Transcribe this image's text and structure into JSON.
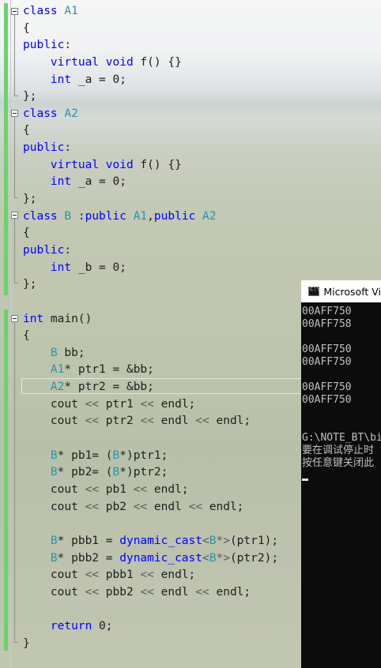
{
  "editor": {
    "lines": [
      [
        {
          "t": "class ",
          "c": "kw"
        },
        {
          "t": "A1",
          "c": "ty"
        }
      ],
      [
        {
          "t": "{"
        }
      ],
      [
        {
          "t": "public",
          "c": "kw"
        },
        {
          "t": ":"
        }
      ],
      [
        {
          "t": "    virtual ",
          "c": "kw"
        },
        {
          "t": "void ",
          "c": "kw"
        },
        {
          "t": "f() {}"
        }
      ],
      [
        {
          "t": "    int ",
          "c": "kw"
        },
        {
          "t": "_a = 0;"
        }
      ],
      [
        {
          "t": "};"
        }
      ],
      [
        {
          "t": "class ",
          "c": "kw"
        },
        {
          "t": "A2",
          "c": "ty"
        }
      ],
      [
        {
          "t": "{"
        }
      ],
      [
        {
          "t": "public",
          "c": "kw"
        },
        {
          "t": ":"
        }
      ],
      [
        {
          "t": "    virtual ",
          "c": "kw"
        },
        {
          "t": "void ",
          "c": "kw"
        },
        {
          "t": "f() {}"
        }
      ],
      [
        {
          "t": "    int ",
          "c": "kw"
        },
        {
          "t": "_a = 0;"
        }
      ],
      [
        {
          "t": "};"
        }
      ],
      [
        {
          "t": "class ",
          "c": "kw"
        },
        {
          "t": "B",
          "c": "ty"
        },
        {
          "t": " :"
        },
        {
          "t": "public ",
          "c": "kw"
        },
        {
          "t": "A1",
          "c": "ty"
        },
        {
          "t": ","
        },
        {
          "t": "public ",
          "c": "kw"
        },
        {
          "t": "A2",
          "c": "ty"
        }
      ],
      [
        {
          "t": "{"
        }
      ],
      [
        {
          "t": "public",
          "c": "kw"
        },
        {
          "t": ":"
        }
      ],
      [
        {
          "t": "    int ",
          "c": "kw"
        },
        {
          "t": "_b = 0;"
        }
      ],
      [
        {
          "t": "};"
        }
      ],
      [
        {
          "t": ""
        }
      ],
      [
        {
          "t": "int ",
          "c": "kw"
        },
        {
          "t": "main()"
        }
      ],
      [
        {
          "t": "{"
        }
      ],
      [
        {
          "t": "    "
        },
        {
          "t": "B",
          "c": "ty"
        },
        {
          "t": " bb;"
        }
      ],
      [
        {
          "t": "    "
        },
        {
          "t": "A1",
          "c": "ty"
        },
        {
          "t": "* ptr1 = &bb;"
        }
      ],
      [
        {
          "t": "    "
        },
        {
          "t": "A2",
          "c": "ty"
        },
        {
          "t": "* ptr2 = &bb;"
        }
      ],
      [
        {
          "t": "    cout "
        },
        {
          "t": "<<",
          "c": "op"
        },
        {
          "t": " ptr1 "
        },
        {
          "t": "<<",
          "c": "op"
        },
        {
          "t": " endl;"
        }
      ],
      [
        {
          "t": "    cout "
        },
        {
          "t": "<<",
          "c": "op"
        },
        {
          "t": " ptr2 "
        },
        {
          "t": "<<",
          "c": "op"
        },
        {
          "t": " endl "
        },
        {
          "t": "<<",
          "c": "op"
        },
        {
          "t": " endl;"
        }
      ],
      [
        {
          "t": ""
        }
      ],
      [
        {
          "t": "    "
        },
        {
          "t": "B",
          "c": "ty"
        },
        {
          "t": "* pb1= ("
        },
        {
          "t": "B",
          "c": "ty"
        },
        {
          "t": "*)ptr1;"
        }
      ],
      [
        {
          "t": "    "
        },
        {
          "t": "B",
          "c": "ty"
        },
        {
          "t": "* pb2= ("
        },
        {
          "t": "B",
          "c": "ty"
        },
        {
          "t": "*)ptr2;"
        }
      ],
      [
        {
          "t": "    cout "
        },
        {
          "t": "<<",
          "c": "op"
        },
        {
          "t": " pb1 "
        },
        {
          "t": "<<",
          "c": "op"
        },
        {
          "t": " endl;"
        }
      ],
      [
        {
          "t": "    cout "
        },
        {
          "t": "<<",
          "c": "op"
        },
        {
          "t": " pb2 "
        },
        {
          "t": "<<",
          "c": "op"
        },
        {
          "t": " endl "
        },
        {
          "t": "<<",
          "c": "op"
        },
        {
          "t": " endl;"
        }
      ],
      [
        {
          "t": ""
        }
      ],
      [
        {
          "t": "    "
        },
        {
          "t": "B",
          "c": "ty"
        },
        {
          "t": "* pbb1 = "
        },
        {
          "t": "dynamic_cast",
          "c": "kw"
        },
        {
          "t": "<",
          "c": "op"
        },
        {
          "t": "B",
          "c": "ty"
        },
        {
          "t": "*>",
          "c": "op"
        },
        {
          "t": "(ptr1);"
        }
      ],
      [
        {
          "t": "    "
        },
        {
          "t": "B",
          "c": "ty"
        },
        {
          "t": "* pbb2 = "
        },
        {
          "t": "dynamic_cast",
          "c": "kw"
        },
        {
          "t": "<",
          "c": "op"
        },
        {
          "t": "B",
          "c": "ty"
        },
        {
          "t": "*>",
          "c": "op"
        },
        {
          "t": "(ptr2);"
        }
      ],
      [
        {
          "t": "    cout "
        },
        {
          "t": "<<",
          "c": "op"
        },
        {
          "t": " pbb1 "
        },
        {
          "t": "<<",
          "c": "op"
        },
        {
          "t": " endl;"
        }
      ],
      [
        {
          "t": "    cout "
        },
        {
          "t": "<<",
          "c": "op"
        },
        {
          "t": " pbb2 "
        },
        {
          "t": "<<",
          "c": "op"
        },
        {
          "t": " endl "
        },
        {
          "t": "<<",
          "c": "op"
        },
        {
          "t": " endl;"
        }
      ],
      [
        {
          "t": ""
        }
      ],
      [
        {
          "t": "    "
        },
        {
          "t": "return ",
          "c": "kw"
        },
        {
          "t": "0;"
        }
      ],
      [
        {
          "t": "}"
        }
      ]
    ]
  },
  "console": {
    "title": "Microsoft Vi",
    "lines": [
      "00AFF750",
      "00AFF758",
      "",
      "00AFF750",
      "00AFF750",
      "",
      "00AFF750",
      "00AFF750",
      "",
      "",
      "G:\\NOTE_BT\\bi",
      "要在调试停止时",
      "按任意键关闭此"
    ]
  },
  "colors": {
    "keyword": "#0000ff",
    "type": "#2b91af",
    "change_bar": "#6ad46a",
    "console_bg": "#0c0c0c"
  }
}
